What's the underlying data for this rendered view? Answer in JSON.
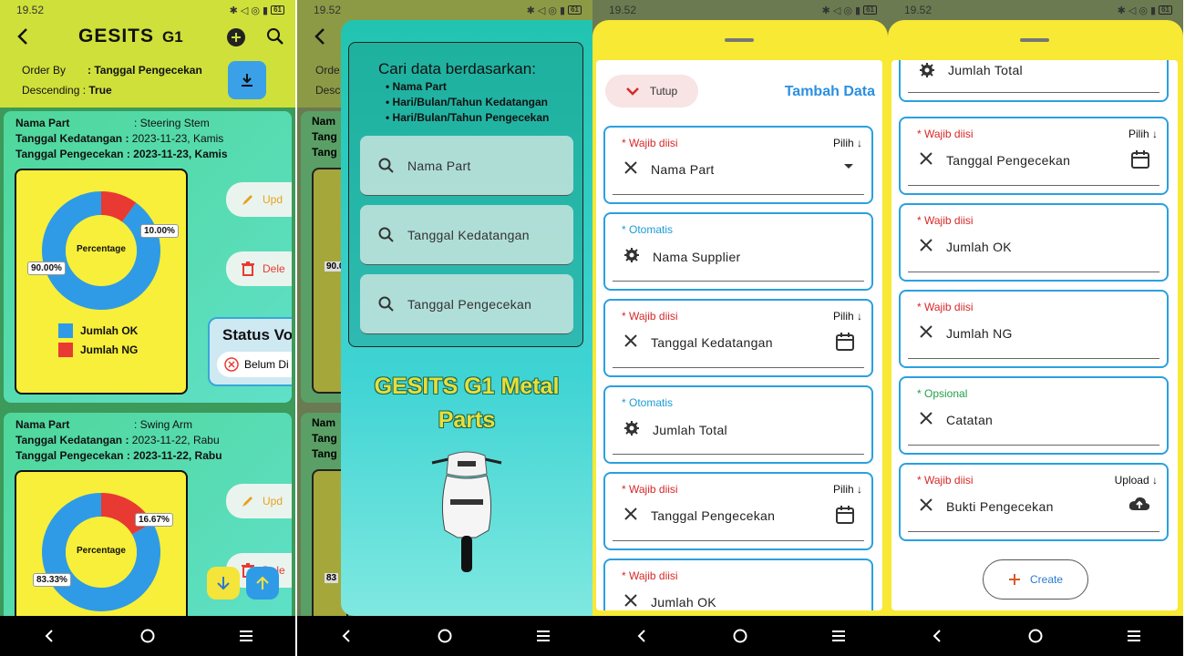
{
  "status": {
    "time": "19.52",
    "battery": "61"
  },
  "screen1": {
    "logo": "GESITS",
    "subtitle": "G1",
    "order_by_label": "Order By",
    "order_by_value": ": Tanggal Pengecekan",
    "descending_label": "Descending :",
    "descending_value": "True",
    "cards": [
      {
        "part_label": "Nama Part",
        "part_value": ": Steering Stem",
        "arrival_label": "Tanggal Kedatangan :",
        "arrival_value": "2023-11-23, Kamis",
        "check_label": "Tanggal Pengecekan :",
        "check_value": "2023-11-23, Kamis",
        "center_label": "Percentage",
        "ok_pct_label": "90.00%",
        "ng_pct_label": "10.00%",
        "ok_fraction": 0.9,
        "legend_ok": "Jumlah OK",
        "legend_ng": "Jumlah NG",
        "update_label": "Upd",
        "delete_label": "Dele",
        "status_title": "Status Vo",
        "status_value": "Belum Di"
      },
      {
        "part_label": "Nama Part",
        "part_value": ": Swing Arm",
        "arrival_label": "Tanggal Kedatangan :",
        "arrival_value": "2023-11-22, Rabu",
        "check_label": "Tanggal Pengecekan :",
        "check_value": "2023-11-22, Rabu",
        "center_label": "Percentage",
        "ok_pct_label": "83.33%",
        "ng_pct_label": "16.67%",
        "ok_fraction": 0.8333,
        "update_label": "Upd",
        "delete_label": "Dele"
      }
    ],
    "colors": {
      "ok": "#2f9be6",
      "ng": "#e83a32"
    }
  },
  "screen2": {
    "back_labels": [
      "19.52",
      "Orde",
      "Desc",
      "Nam",
      "Tang",
      "Tang",
      "90.0",
      "Nam",
      "Tang",
      "Tang",
      "83"
    ],
    "filter_title": "Cari data berdasarkan:",
    "bullets": [
      "• Nama Part",
      "• Hari/Bulan/Tahun Kedatangan",
      "• Hari/Bulan/Tahun Pengecekan"
    ],
    "searches": [
      "Nama Part",
      "Tanggal Kedatangan",
      "Tanggal Pengecekan"
    ],
    "brand_line1": "GESITS G1 Metal",
    "brand_line2": "Parts"
  },
  "screen3": {
    "close_label": "Tutup",
    "title": "Tambah Data",
    "fields": [
      {
        "tag": "* Wajib diisi",
        "kind": "req",
        "right": "Pilih  ↓",
        "label": "Nama Part",
        "lead": "x",
        "trail": "dropdown"
      },
      {
        "tag": "* Otomatis",
        "kind": "auto",
        "right": "",
        "label": "Nama Supplier",
        "lead": "gear",
        "trail": ""
      },
      {
        "tag": "* Wajib diisi",
        "kind": "req",
        "right": "Pilih  ↓",
        "label": "Tanggal Kedatangan",
        "lead": "x",
        "trail": "calendar"
      },
      {
        "tag": "* Otomatis",
        "kind": "auto",
        "right": "",
        "label": "Jumlah Total",
        "lead": "gear",
        "trail": ""
      },
      {
        "tag": "* Wajib diisi",
        "kind": "req",
        "right": "Pilih  ↓",
        "label": "Tanggal Pengecekan",
        "lead": "x",
        "trail": "calendar"
      },
      {
        "tag": "* Wajib diisi",
        "kind": "req",
        "right": "",
        "label": "Jumlah OK",
        "lead": "x",
        "trail": ""
      }
    ]
  },
  "screen4": {
    "top_label": "Jumlah Total",
    "fields": [
      {
        "tag": "* Wajib diisi",
        "kind": "req",
        "right": "Pilih  ↓",
        "label": "Tanggal Pengecekan",
        "lead": "x",
        "trail": "calendar"
      },
      {
        "tag": "* Wajib diisi",
        "kind": "req",
        "right": "",
        "label": "Jumlah OK",
        "lead": "x",
        "trail": ""
      },
      {
        "tag": "* Wajib diisi",
        "kind": "req",
        "right": "",
        "label": "Jumlah NG",
        "lead": "x",
        "trail": ""
      },
      {
        "tag": "* Opsional",
        "kind": "opt",
        "right": "",
        "label": "Catatan",
        "lead": "x",
        "trail": ""
      },
      {
        "tag": "* Wajib diisi",
        "kind": "req",
        "right": "Upload  ↓",
        "label": "Bukti Pengecekan",
        "lead": "x",
        "trail": "upload"
      }
    ],
    "create_label": "Create"
  }
}
